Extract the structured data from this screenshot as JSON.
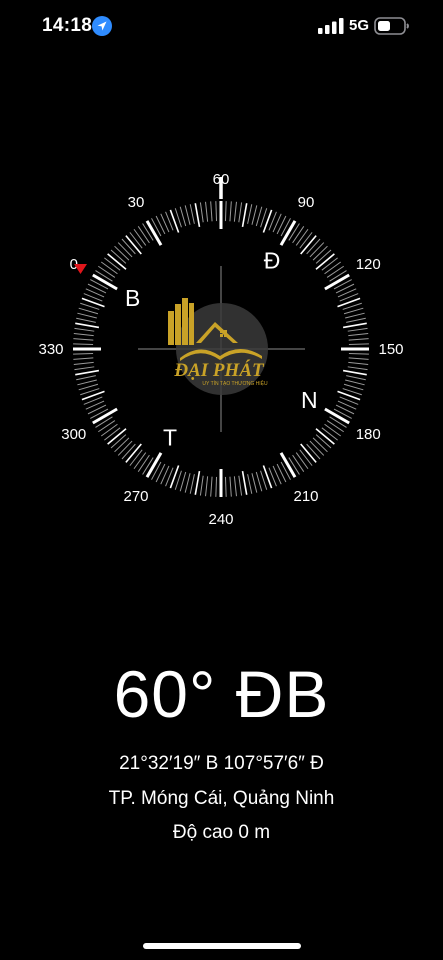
{
  "status_bar": {
    "time": "14:18",
    "network": "5G",
    "icons": [
      "location-arrow-icon",
      "cellular-signal-icon",
      "battery-icon"
    ]
  },
  "compass": {
    "heading_degrees": 60,
    "degree_labels": [
      "0",
      "30",
      "60",
      "90",
      "120",
      "150",
      "180",
      "210",
      "240",
      "270",
      "300",
      "330"
    ],
    "cardinal_labels": {
      "north": "B",
      "east": "Đ",
      "south": "N",
      "west": "T"
    },
    "target_marker_color": "#e0161b",
    "watermark": {
      "brand": "ĐẠI PHÁT",
      "tagline": "UY TÍN TẠO THƯƠNG HIỆU",
      "color": "#c9a227"
    }
  },
  "reading": {
    "heading": "60° ĐB",
    "coordinates": "21°32′19″ B  107°57′6″ Đ",
    "place": "TP. Móng Cái, Quảng Ninh",
    "elevation": "Độ cao 0 m"
  }
}
